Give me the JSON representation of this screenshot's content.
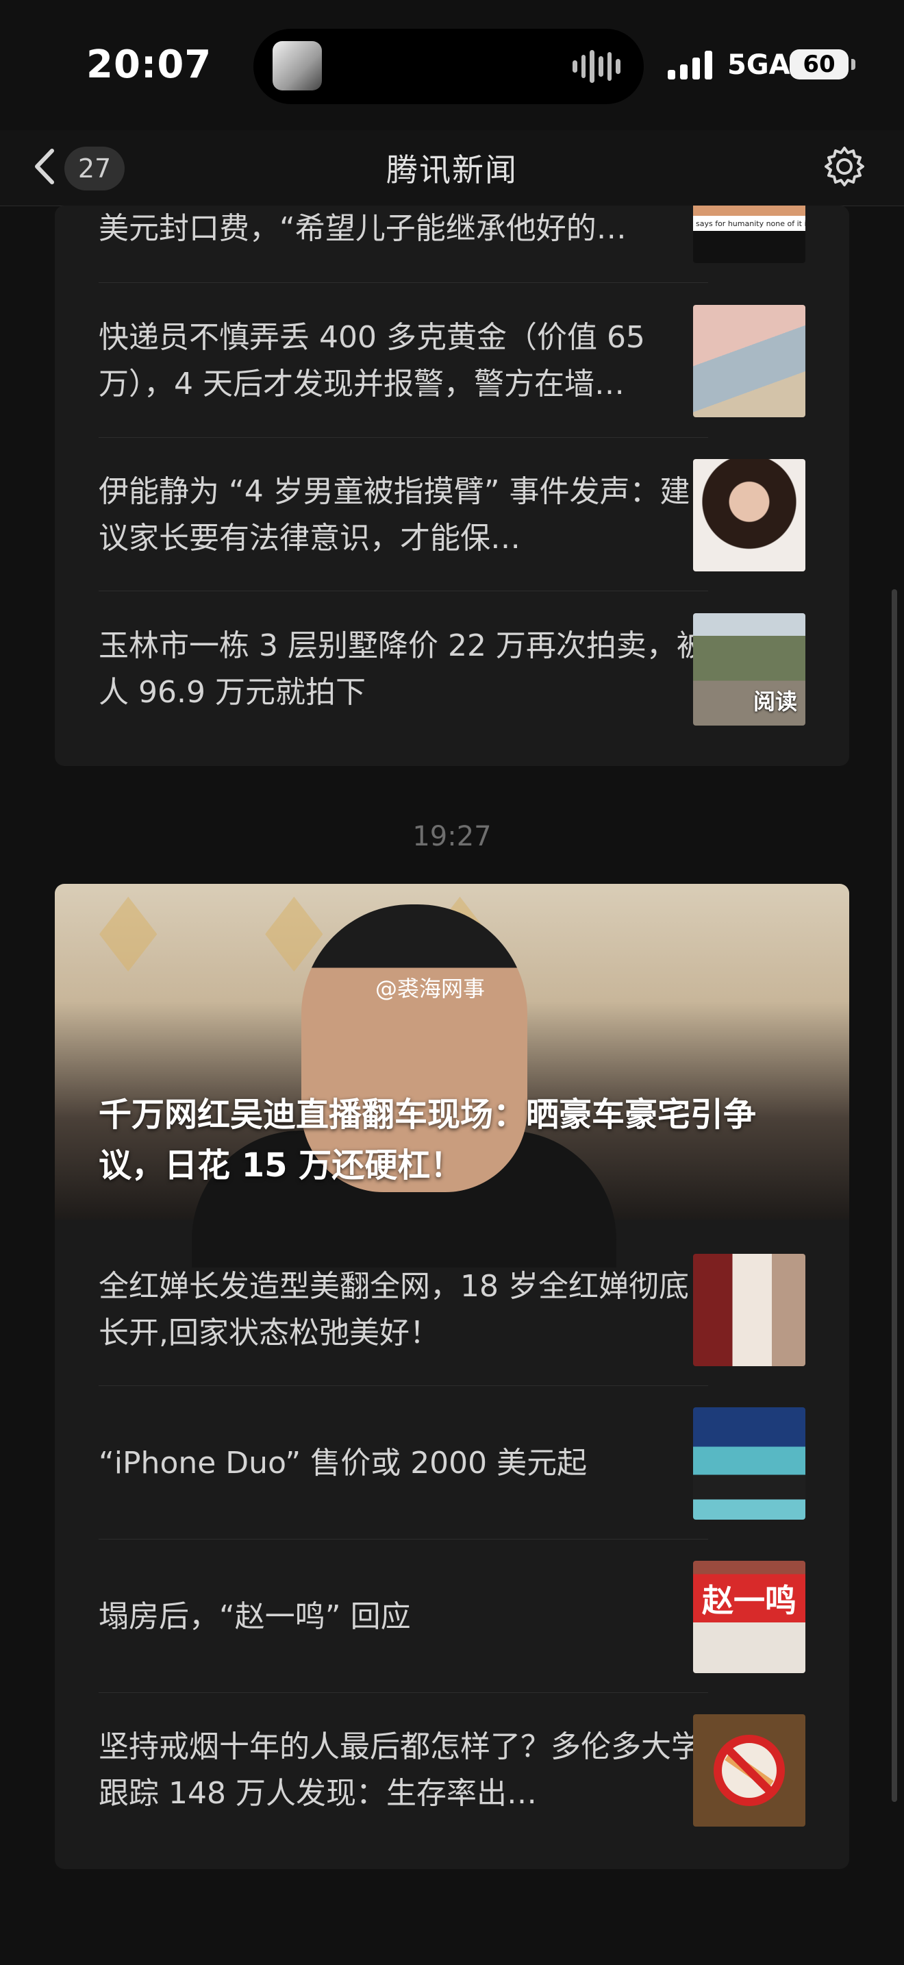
{
  "status_bar": {
    "time": "20:07",
    "network": "5GA",
    "battery": "60"
  },
  "nav": {
    "back_count": "27",
    "title": "腾讯新闻"
  },
  "card1": {
    "items": [
      {
        "title": "美元封口费，“希望儿子能继承他好的…",
        "thumb_text": "says for humanity none of it is posit / 他说“为了人类”时，没有一句是 / n Festival"
      },
      {
        "title": "快递员不慎弄丢 400 多克黄金（价值 65 万），4 天后才发现并报警，警方在墙…"
      },
      {
        "title": "伊能静为 “4 岁男童被指摸臂” 事件发声：建议家长要有法律意识，才能保…"
      },
      {
        "title": "玉林市一栋 3 层别墅降价 22 万再次拍卖，被人 96.9 万元就拍下",
        "thumb_overlay": "阅读"
      }
    ]
  },
  "timestamp": "19:27",
  "card2": {
    "hero_title": "千万网红吴迪直播翻车现场：晒豪车豪宅引争议，日花 15 万还硬杠！",
    "hero_watermark": "@裘海网事",
    "items": [
      {
        "title": "全红婵长发造型美翻全网，18 岁全红婵彻底长开,回家状态松弛美好！"
      },
      {
        "title": "“iPhone Duo” 售价或 2000 美元起"
      },
      {
        "title": "塌房后，“赵一鸣” 回应",
        "thumb_text": "赵一鸣"
      },
      {
        "title": "坚持戒烟十年的人最后都怎样了？多伦多大学跟踪 148 万人发现：生存率出…"
      }
    ]
  }
}
